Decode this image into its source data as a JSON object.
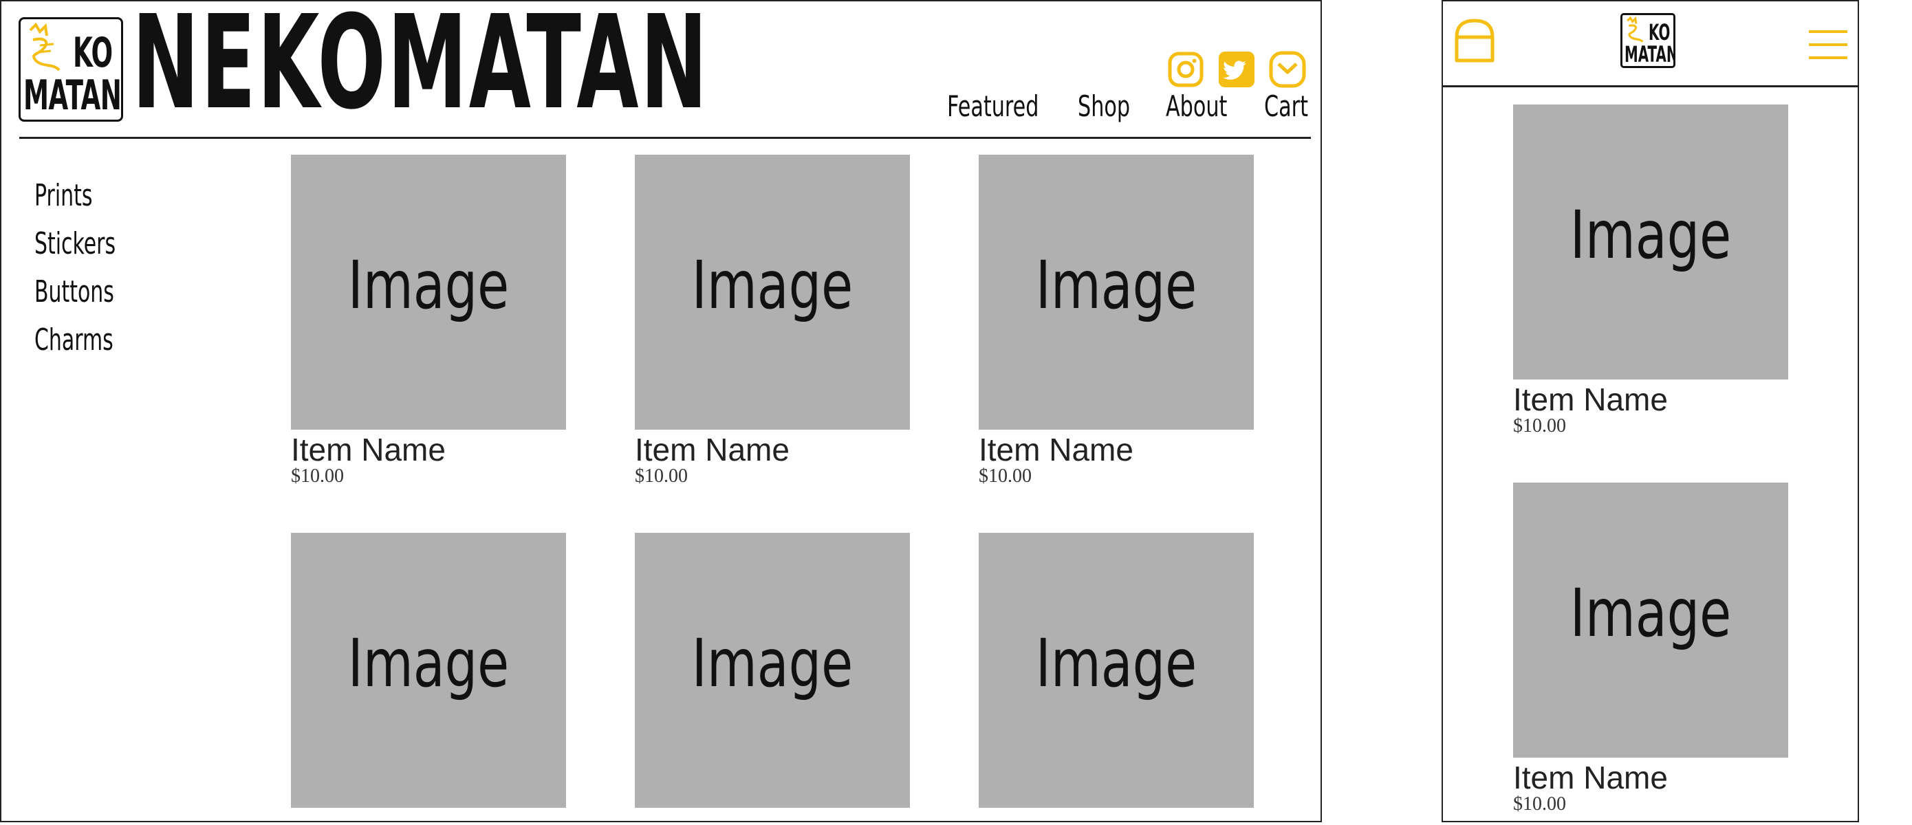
{
  "desktop": {
    "logo": {
      "line1": "KO",
      "line2": "MATAN"
    },
    "brand_title": "NEKOMATAN",
    "social_icons": [
      "instagram-icon",
      "twitter-icon",
      "mail-icon"
    ],
    "nav": [
      "Featured",
      "Shop",
      "About",
      "Cart"
    ],
    "categories": [
      "Prints",
      "Stickers",
      "Buttons",
      "Charms"
    ],
    "products": [
      {
        "image_label": "Image",
        "name": "Item Name",
        "price": "$10.00"
      },
      {
        "image_label": "Image",
        "name": "Item Name",
        "price": "$10.00"
      },
      {
        "image_label": "Image",
        "name": "Item Name",
        "price": "$10.00"
      },
      {
        "image_label": "Image"
      },
      {
        "image_label": "Image"
      },
      {
        "image_label": "Image"
      }
    ]
  },
  "mobile": {
    "logo": {
      "line1": "KO",
      "line2": "MATAN"
    },
    "icons": [
      "bag-icon",
      "hamburger-menu-icon"
    ],
    "products": [
      {
        "image_label": "Image",
        "name": "Item Name",
        "price": "$10.00"
      },
      {
        "image_label": "Image",
        "name": "Item Name",
        "price": "$10.00"
      }
    ]
  },
  "colors": {
    "accent": "#F5BE14",
    "placeholder": "#B0B0B0",
    "ink": "#111111"
  }
}
